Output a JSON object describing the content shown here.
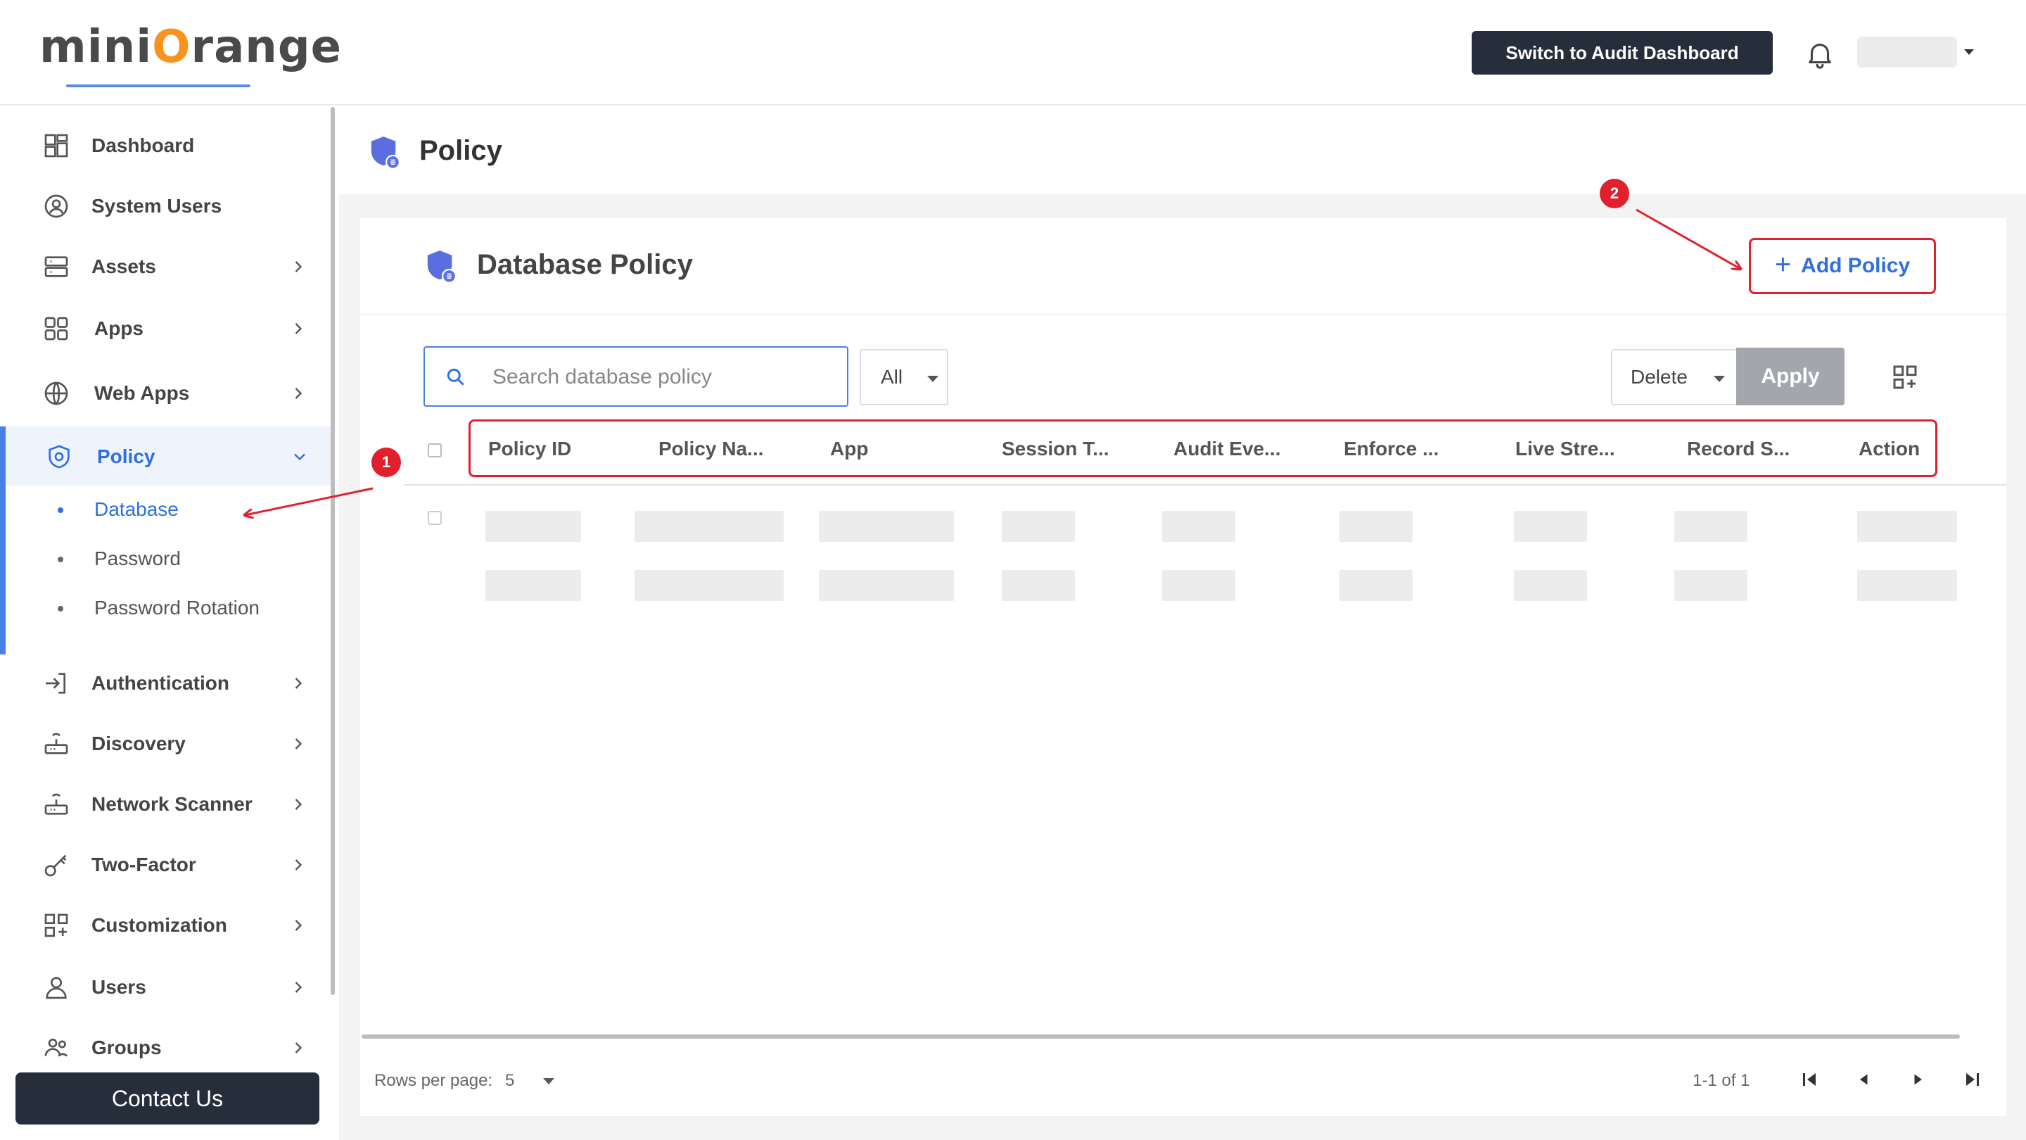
{
  "brand": {
    "logo_pre": "mini",
    "logo_o": "O",
    "logo_post": "range"
  },
  "header": {
    "audit_button": "Switch to Audit Dashboard"
  },
  "sidebar": {
    "items": [
      {
        "label": "Dashboard"
      },
      {
        "label": "System Users"
      },
      {
        "label": "Assets"
      },
      {
        "label": "Apps"
      },
      {
        "label": "Web Apps"
      },
      {
        "label": "Policy"
      },
      {
        "label": "Authentication"
      },
      {
        "label": "Discovery"
      },
      {
        "label": "Network Scanner"
      },
      {
        "label": "Two-Factor"
      },
      {
        "label": "Customization"
      },
      {
        "label": "Users"
      },
      {
        "label": "Groups"
      }
    ],
    "policy_sub": [
      {
        "label": "Database"
      },
      {
        "label": "Password"
      },
      {
        "label": "Password Rotation"
      }
    ],
    "contact": "Contact Us"
  },
  "page": {
    "title": "Policy"
  },
  "card": {
    "title": "Database Policy",
    "add_button": "Add Policy",
    "add_plus": "+",
    "search_placeholder": "Search database policy",
    "filter_value": "All",
    "bulk_action": "Delete",
    "apply": "Apply"
  },
  "table": {
    "columns": [
      "Policy ID",
      "Policy Na...",
      "App",
      "Session T...",
      "Audit Eve...",
      "Enforce ...",
      "Live Stre...",
      "Record S...",
      "Action"
    ]
  },
  "pagination": {
    "rows_per_page_label": "Rows per page:",
    "rows_per_page_value": "5",
    "range": "1-1 of 1"
  },
  "annotations": {
    "step1": "1",
    "step2": "2"
  },
  "colors": {
    "accent": "#2f6fe0",
    "highlight": "#e0202e",
    "dark_button": "#262d3b",
    "brand_orange": "#f7931e"
  }
}
